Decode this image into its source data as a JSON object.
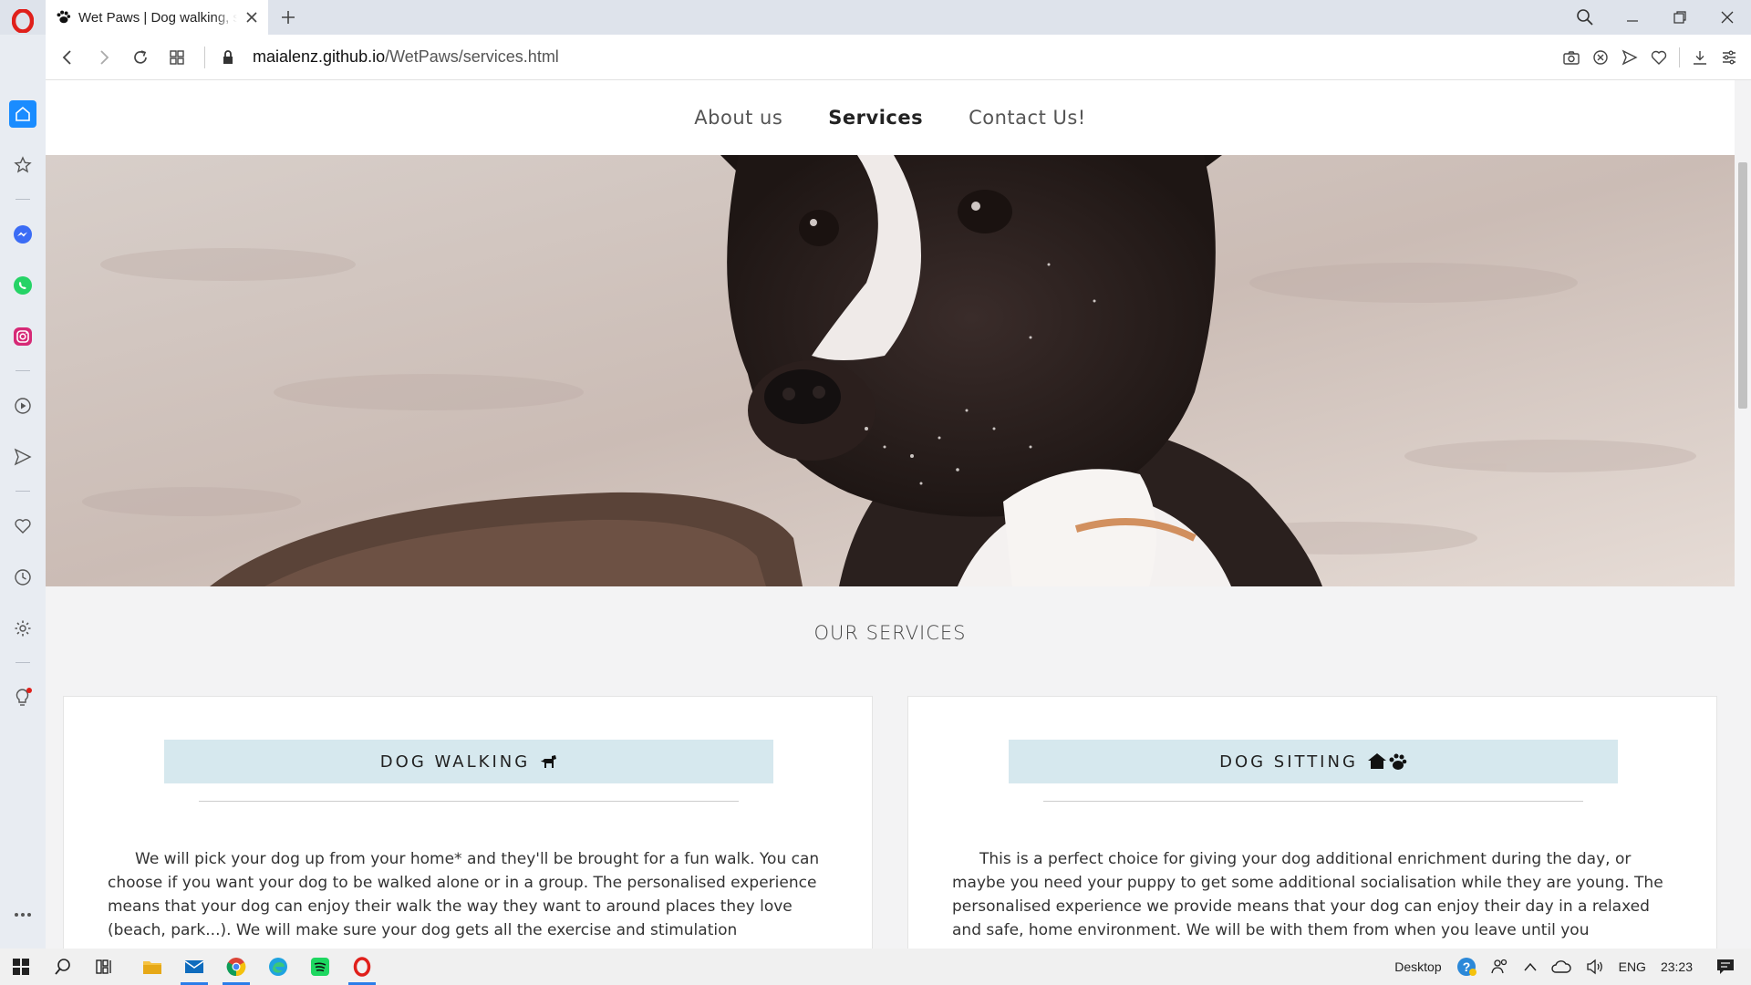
{
  "browser": {
    "tab_title": "Wet Paws | Dog walking, sitting",
    "url_host": "maialenz.github.io",
    "url_path": "/WetPaws/services.html"
  },
  "site": {
    "nav": [
      "About us",
      "Services",
      "Contact Us!"
    ],
    "active_nav": "Services",
    "section_heading": "OUR SERVICES",
    "cards": [
      {
        "title": "DOG WALKING",
        "icon": "dog-icon",
        "text": "We will pick your dog up from your home* and they'll be brought for a fun walk. You can choose if you want your dog to be walked alone or in a group. The personalised experience means that your dog can enjoy their walk the way they want to around places they love (beach, park...). We will make sure your dog gets all the exercise and stimulation"
      },
      {
        "title": "DOG SITTING",
        "icon": "home-paw-icon",
        "text": "This is a perfect choice for giving your dog additional enrichment during the day, or maybe you need your puppy to get some additional socialisation while they are young. The personalised experience we provide means that your dog can enjoy their day in a relaxed and safe, home environment. We will be with them from when you leave until you"
      }
    ]
  },
  "taskbar": {
    "desktop_label": "Desktop",
    "language": "ENG",
    "time": "23:23"
  },
  "colors": {
    "chip_bg": "#d6e8ee",
    "page_bg": "#f3f3f4",
    "opera_red": "#e0201b"
  }
}
